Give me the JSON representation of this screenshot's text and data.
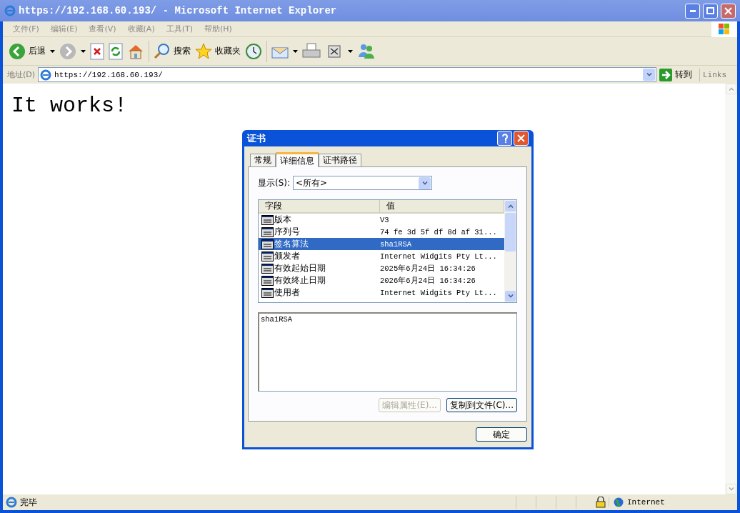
{
  "window": {
    "title": "https://192.168.60.193/ - Microsoft Internet Explorer"
  },
  "menu": [
    "文件(F)",
    "编辑(E)",
    "查看(V)",
    "收藏(A)",
    "工具(T)",
    "帮助(H)"
  ],
  "toolbar": {
    "back": "后退",
    "search": "搜索",
    "favorites": "收藏夹"
  },
  "address": {
    "label": "地址(D)",
    "value": "https://192.168.60.193/",
    "go": "转到",
    "links": "Links"
  },
  "page": {
    "heading": "It works!"
  },
  "dialog": {
    "title": "证书",
    "tabs": [
      {
        "label": "常规",
        "selected": false
      },
      {
        "label": "详细信息",
        "selected": true
      },
      {
        "label": "证书路径",
        "selected": false
      }
    ],
    "show_label": "显示(S):",
    "show_value": "<所有>",
    "columns": [
      "字段",
      "值"
    ],
    "rows": [
      {
        "field": "版本",
        "value": "V3",
        "selected": false
      },
      {
        "field": "序列号",
        "value": "74 fe 3d 5f df 8d af 31...",
        "selected": false
      },
      {
        "field": "签名算法",
        "value": "sha1RSA",
        "selected": true
      },
      {
        "field": "颁发者",
        "value": "Internet Widgits Pty Lt...",
        "selected": false
      },
      {
        "field": "有效起始日期",
        "value": "2025年6月24日 16:34:26",
        "selected": false
      },
      {
        "field": "有效终止日期",
        "value": "2026年6月24日 16:34:26",
        "selected": false
      },
      {
        "field": "使用者",
        "value": "Internet Widgits Pty Lt...",
        "selected": false
      }
    ],
    "detail": "sha1RSA",
    "buttons": [
      {
        "label": "编辑属性(E)...",
        "disabled": true
      },
      {
        "label": "复制到文件(C)...",
        "disabled": false
      }
    ],
    "ok": "确定"
  },
  "status_bar": {
    "text": "完毕",
    "zone": "Internet"
  }
}
